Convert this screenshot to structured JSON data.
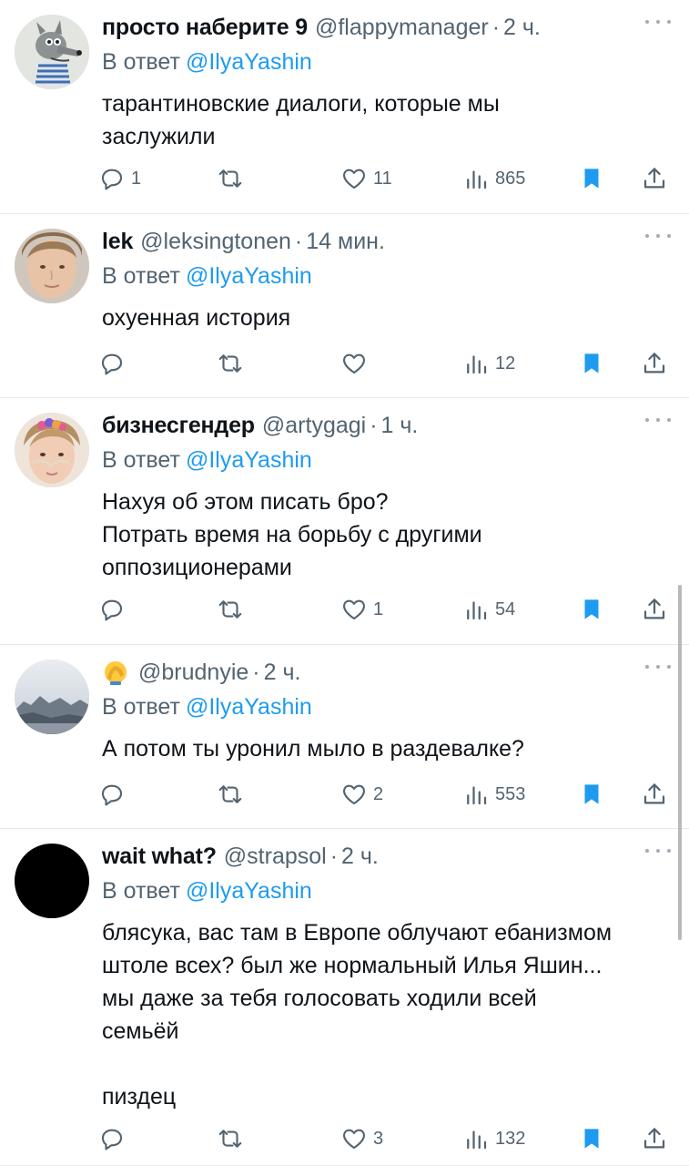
{
  "colors": {
    "link": "#1d9bf0",
    "muted": "#536471",
    "bookmark": "#1d9bf0",
    "divider": "#e6e9eb"
  },
  "reply_prefix": "В ответ",
  "tweets": [
    {
      "name": "просто наберите 9",
      "handle": "@flappymanager",
      "time": "2 ч.",
      "reply_to": "@IlyaYashin",
      "lines": [
        "тарантиновские диалоги, которые мы",
        "заслужили"
      ],
      "replies": "1",
      "retweets": "",
      "likes": "11",
      "views": "865",
      "avatar": "wolf-cartoon"
    },
    {
      "name": "lek",
      "handle": "@leksingtonen",
      "time": "14 мин.",
      "reply_to": "@IlyaYashin",
      "lines": [
        "охуенная история"
      ],
      "replies": "",
      "retweets": "",
      "likes": "",
      "views": "12",
      "avatar": "face-photo"
    },
    {
      "name": "бизнесгендер",
      "handle": "@artygagi",
      "time": "1 ч.",
      "reply_to": "@IlyaYashin",
      "lines": [
        "Нахуя об этом писать бро?",
        "Потрать время на борьбу с другими",
        "оппозиционерами"
      ],
      "replies": "",
      "retweets": "",
      "likes": "1",
      "views": "54",
      "avatar": "face-photo-flowers"
    },
    {
      "name": "",
      "name_icon": "facepalm-emoji",
      "handle": "@brudnyie",
      "time": "2 ч.",
      "reply_to": "@IlyaYashin",
      "lines": [
        "А потом ты уронил мыло в раздевалке?"
      ],
      "replies": "",
      "retweets": "",
      "likes": "2",
      "views": "553",
      "avatar": "landscape-photo"
    },
    {
      "name": "wait what?",
      "handle": "@strapsol",
      "time": "2 ч.",
      "reply_to": "@IlyaYashin",
      "lines": [
        "блясука, вас там в Европе облучают ебанизмом",
        "штоле всех? был же нормальный Илья Яшин...",
        "мы даже за тебя голосовать ходили всей",
        "семьёй",
        "",
        "пиздец"
      ],
      "replies": "",
      "retweets": "",
      "likes": "3",
      "views": "132",
      "avatar": "black-circle"
    }
  ]
}
